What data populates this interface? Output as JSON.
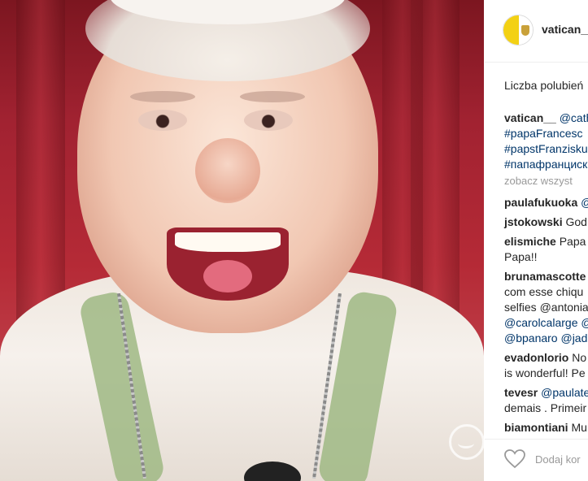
{
  "post": {
    "username": "vatican__",
    "likes_label": "Liczba polubień",
    "caption": {
      "author": "vatican__",
      "mention": "@cath",
      "tags": [
        "#papaFrancesc",
        "#papstFranzisku",
        "#папафранциск"
      ]
    },
    "view_all_comments": "zobacz wszyst",
    "comments": [
      {
        "author": "paulafukuoka",
        "lines": [
          "@"
        ]
      },
      {
        "author": "jstokowski",
        "lines": [
          "God"
        ]
      },
      {
        "author": "elismiche",
        "lines": [
          "Papa",
          "Papa!!"
        ]
      },
      {
        "author": "brunamascotte",
        "lines": [
          "",
          "com esse chiqu",
          "selfies @antonia",
          "@carolcalarge @",
          "@bpanaro @jade"
        ]
      },
      {
        "author": "evadonlorio",
        "lines": [
          "No",
          "is wonderful! Pe"
        ]
      },
      {
        "author": "tevesr",
        "lines": [
          "@paulate",
          "demais . Primeir"
        ]
      },
      {
        "author": "biamontiani",
        "lines": [
          "Mu"
        ]
      }
    ],
    "add_comment_placeholder": "Dodaj kor"
  },
  "icons": {
    "avatar": "vatican-flag-avatar",
    "like": "heart-outline-icon",
    "watermark": "site-logo-watermark"
  },
  "colors": {
    "hashtag": "#003569",
    "muted": "#999999",
    "text": "#262626",
    "flag_yellow": "#f3d114"
  }
}
